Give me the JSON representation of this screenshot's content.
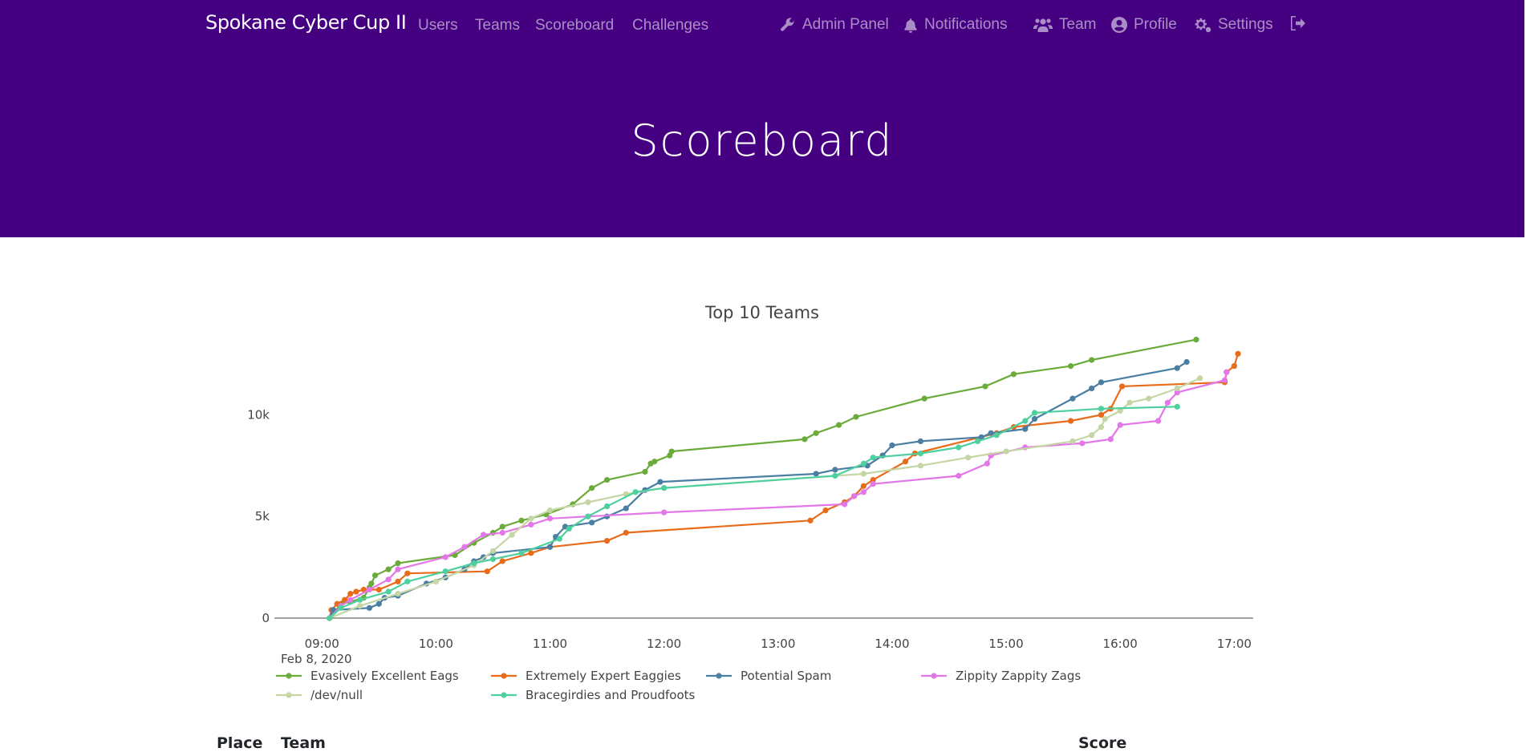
{
  "navbar": {
    "brand": "Spokane Cyber Cup II",
    "left_links": [
      "Users",
      "Teams",
      "Scoreboard",
      "Challenges"
    ],
    "admin_panel": "Admin Panel",
    "notifications": "Notifications",
    "team": "Team",
    "profile": "Profile",
    "settings": "Settings",
    "logout_icon": "sign-out-icon",
    "color": "#440080"
  },
  "page": {
    "title": "Scoreboard"
  },
  "chart_data": {
    "type": "line",
    "title": "Top 10 Teams",
    "xlabel": "",
    "ylabel": "",
    "date_label": "Feb 8, 2020",
    "x_ticks": [
      "09:00",
      "10:00",
      "11:00",
      "12:00",
      "13:00",
      "14:00",
      "15:00",
      "16:00",
      "17:00"
    ],
    "x_range": [
      "08:35",
      "17:10"
    ],
    "y_ticks": [
      0,
      5000,
      10000
    ],
    "y_tick_labels": [
      "0",
      "5k",
      "10k"
    ],
    "ylim": [
      0,
      14000
    ],
    "legend_placement": "bottom",
    "series": [
      {
        "name": "Evasively Excellent Eags",
        "color": "#6aab3a",
        "points": [
          [
            "09:04",
            0
          ],
          [
            "09:10",
            700
          ],
          [
            "09:15",
            800
          ],
          [
            "09:22",
            1000
          ],
          [
            "09:25",
            1500
          ],
          [
            "09:26",
            1700
          ],
          [
            "09:28",
            2100
          ],
          [
            "09:35",
            2400
          ],
          [
            "09:40",
            2700
          ],
          [
            "10:10",
            3100
          ],
          [
            "10:20",
            3700
          ],
          [
            "10:30",
            4200
          ],
          [
            "10:35",
            4500
          ],
          [
            "10:45",
            4800
          ],
          [
            "10:58",
            5100
          ],
          [
            "11:12",
            5600
          ],
          [
            "11:22",
            6400
          ],
          [
            "11:30",
            6800
          ],
          [
            "11:50",
            7200
          ],
          [
            "11:53",
            7600
          ],
          [
            "11:55",
            7700
          ],
          [
            "12:03",
            8000
          ],
          [
            "12:04",
            8200
          ],
          [
            "13:14",
            8800
          ],
          [
            "13:20",
            9100
          ],
          [
            "13:32",
            9500
          ],
          [
            "13:41",
            9900
          ],
          [
            "14:17",
            10800
          ],
          [
            "14:49",
            11400
          ],
          [
            "15:04",
            12000
          ],
          [
            "15:34",
            12400
          ],
          [
            "15:45",
            12700
          ],
          [
            "16:40",
            13700
          ]
        ]
      },
      {
        "name": "Extremely Expert Eaggies",
        "color": "#e86b1a",
        "points": [
          [
            "09:04",
            0
          ],
          [
            "09:05",
            400
          ],
          [
            "09:08",
            700
          ],
          [
            "09:12",
            900
          ],
          [
            "09:15",
            1200
          ],
          [
            "09:18",
            1300
          ],
          [
            "09:22",
            1400
          ],
          [
            "09:30",
            1400
          ],
          [
            "09:40",
            1800
          ],
          [
            "09:45",
            2200
          ],
          [
            "10:27",
            2300
          ],
          [
            "10:35",
            2800
          ],
          [
            "10:50",
            3200
          ],
          [
            "11:00",
            3500
          ],
          [
            "11:30",
            3800
          ],
          [
            "11:40",
            4200
          ],
          [
            "13:17",
            4800
          ],
          [
            "13:25",
            5300
          ],
          [
            "13:35",
            5700
          ],
          [
            "13:40",
            6000
          ],
          [
            "13:45",
            6500
          ],
          [
            "13:50",
            6800
          ],
          [
            "14:07",
            7700
          ],
          [
            "14:12",
            8100
          ],
          [
            "14:55",
            9100
          ],
          [
            "15:04",
            9400
          ],
          [
            "15:34",
            9700
          ],
          [
            "15:50",
            10000
          ],
          [
            "15:55",
            10300
          ],
          [
            "16:01",
            11400
          ],
          [
            "16:55",
            11600
          ],
          [
            "16:56",
            12100
          ],
          [
            "17:00",
            12400
          ],
          [
            "17:02",
            13000
          ]
        ]
      },
      {
        "name": "Potential Spam",
        "color": "#4a7ea3",
        "points": [
          [
            "09:04",
            0
          ],
          [
            "09:06",
            400
          ],
          [
            "09:25",
            500
          ],
          [
            "09:30",
            700
          ],
          [
            "09:33",
            1000
          ],
          [
            "09:40",
            1100
          ],
          [
            "09:55",
            1700
          ],
          [
            "10:05",
            2000
          ],
          [
            "10:15",
            2400
          ],
          [
            "10:20",
            2800
          ],
          [
            "10:25",
            3000
          ],
          [
            "10:30",
            3200
          ],
          [
            "11:00",
            3500
          ],
          [
            "11:03",
            4000
          ],
          [
            "11:08",
            4500
          ],
          [
            "11:22",
            4700
          ],
          [
            "11:30",
            5000
          ],
          [
            "11:40",
            5400
          ],
          [
            "11:50",
            6300
          ],
          [
            "11:58",
            6700
          ],
          [
            "13:20",
            7100
          ],
          [
            "13:30",
            7300
          ],
          [
            "13:47",
            7500
          ],
          [
            "13:55",
            8000
          ],
          [
            "14:00",
            8500
          ],
          [
            "14:15",
            8700
          ],
          [
            "14:47",
            8900
          ],
          [
            "14:52",
            9100
          ],
          [
            "15:10",
            9300
          ],
          [
            "15:15",
            9800
          ],
          [
            "15:35",
            10800
          ],
          [
            "15:45",
            11300
          ],
          [
            "15:50",
            11600
          ],
          [
            "16:30",
            12300
          ],
          [
            "16:35",
            12600
          ]
        ]
      },
      {
        "name": "Zippity Zappity Zags",
        "color": "#e377e8",
        "points": [
          [
            "09:04",
            0
          ],
          [
            "09:10",
            600
          ],
          [
            "09:15",
            900
          ],
          [
            "09:25",
            1400
          ],
          [
            "09:35",
            1900
          ],
          [
            "09:40",
            2400
          ],
          [
            "10:05",
            3000
          ],
          [
            "10:15",
            3500
          ],
          [
            "10:25",
            4100
          ],
          [
            "10:35",
            4200
          ],
          [
            "10:50",
            4600
          ],
          [
            "11:00",
            4900
          ],
          [
            "11:20",
            5000
          ],
          [
            "12:00",
            5200
          ],
          [
            "13:35",
            5600
          ],
          [
            "13:40",
            6000
          ],
          [
            "13:45",
            6200
          ],
          [
            "13:50",
            6600
          ],
          [
            "14:35",
            7000
          ],
          [
            "14:50",
            7600
          ],
          [
            "14:52",
            8000
          ],
          [
            "15:10",
            8400
          ],
          [
            "15:40",
            8600
          ],
          [
            "15:55",
            8800
          ],
          [
            "16:00",
            9500
          ],
          [
            "16:20",
            9700
          ],
          [
            "16:25",
            10600
          ],
          [
            "16:30",
            11100
          ],
          [
            "16:55",
            11700
          ],
          [
            "16:56",
            12100
          ]
        ]
      },
      {
        "name": "/dev/null",
        "color": "#c4d6a4",
        "points": [
          [
            "09:04",
            0
          ],
          [
            "09:20",
            600
          ],
          [
            "09:40",
            1200
          ],
          [
            "10:00",
            1800
          ],
          [
            "10:20",
            2600
          ],
          [
            "10:30",
            3300
          ],
          [
            "10:40",
            4100
          ],
          [
            "10:50",
            4900
          ],
          [
            "11:00",
            5300
          ],
          [
            "11:20",
            5700
          ],
          [
            "11:40",
            6100
          ],
          [
            "12:00",
            6400
          ],
          [
            "13:45",
            7100
          ],
          [
            "14:15",
            7500
          ],
          [
            "14:40",
            7900
          ],
          [
            "15:00",
            8200
          ],
          [
            "15:35",
            8700
          ],
          [
            "15:45",
            9000
          ],
          [
            "15:50",
            9400
          ],
          [
            "15:52",
            9800
          ],
          [
            "16:00",
            10200
          ],
          [
            "16:05",
            10600
          ],
          [
            "16:15",
            10800
          ],
          [
            "16:30",
            11300
          ],
          [
            "16:42",
            11800
          ]
        ]
      },
      {
        "name": "Bracegirdies and Proudfoots",
        "color": "#4dd09e",
        "points": [
          [
            "09:04",
            0
          ],
          [
            "09:10",
            500
          ],
          [
            "09:20",
            900
          ],
          [
            "09:35",
            1300
          ],
          [
            "09:45",
            1800
          ],
          [
            "10:05",
            2300
          ],
          [
            "10:20",
            2700
          ],
          [
            "10:30",
            2900
          ],
          [
            "10:45",
            3200
          ],
          [
            "11:05",
            3900
          ],
          [
            "11:10",
            4400
          ],
          [
            "11:20",
            5000
          ],
          [
            "11:30",
            5500
          ],
          [
            "11:45",
            6200
          ],
          [
            "12:00",
            6400
          ],
          [
            "13:30",
            7000
          ],
          [
            "13:45",
            7600
          ],
          [
            "13:50",
            7900
          ],
          [
            "14:15",
            8100
          ],
          [
            "14:35",
            8400
          ],
          [
            "14:45",
            8700
          ],
          [
            "14:55",
            9000
          ],
          [
            "15:10",
            9700
          ],
          [
            "15:15",
            10100
          ],
          [
            "15:50",
            10300
          ],
          [
            "16:30",
            10400
          ]
        ]
      }
    ]
  },
  "table": {
    "headers": [
      "Place",
      "Team",
      "Score"
    ]
  }
}
